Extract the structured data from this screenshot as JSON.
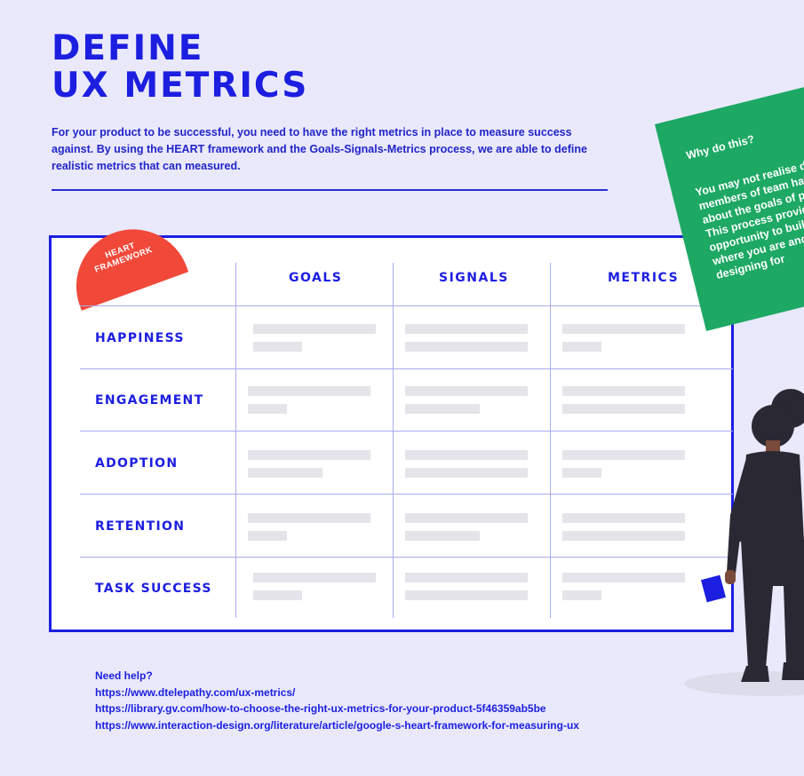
{
  "header": {
    "title_line1": "DEFINE",
    "title_line2": "UX METRICS",
    "intro": "For your product to be successful, you need to have the right metrics in place to measure success against. By using the HEART framework and the Goals-Signals-Metrics process, we are able to define realistic metrics that can measured."
  },
  "badge": {
    "line1": "HEART",
    "line2": "FRAMEWORK"
  },
  "table": {
    "columns": [
      "GOALS",
      "SIGNALS",
      "METRICS"
    ],
    "rows": [
      "HAPPINESS",
      "ENGAGEMENT",
      "ADOPTION",
      "RETENTION",
      "TASK SUCCESS"
    ]
  },
  "note": {
    "question": "Why do this?",
    "body": "You may not realise different members of team have different about the goals of product. This process provides an opportunity to build consensus where you are and what you are designing for"
  },
  "help": {
    "heading": "Need help?",
    "links": [
      "https://www.dtelepathy.com/ux-metrics/",
      "https://library.gv.com/how-to-choose-the-right-ux-metrics-for-your-product-5f46359ab5be",
      "https://www.interaction-design.org/literature/article/google-s-heart-framework-for-measuring-ux"
    ]
  },
  "colors": {
    "background": "#e9e9fb",
    "brand_blue": "#1c1ee0",
    "badge_red": "#f0493a",
    "note_green": "#1da864",
    "placeholder_bar": "#e4e4ea"
  }
}
